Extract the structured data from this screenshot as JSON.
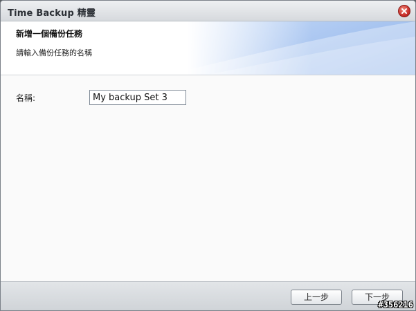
{
  "window": {
    "title": "Time Backup 精靈"
  },
  "header": {
    "title": "新增一個備份任務",
    "subtitle": "請輸入備份任務的名稱"
  },
  "form": {
    "name_label": "名稱:",
    "name_value": "My backup Set 3"
  },
  "footer": {
    "back_label": "上一步",
    "next_label": "下一步"
  },
  "watermark": "#356216",
  "icons": {
    "close": "close-icon"
  },
  "colors": {
    "close_button": "#c9302c",
    "header_gradient_end": "#8fb3ea"
  }
}
